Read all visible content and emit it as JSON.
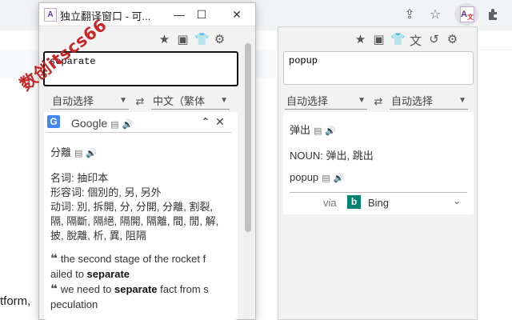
{
  "page_fragment": "tform,",
  "browser": {
    "icons": [
      "share-icon",
      "star-icon",
      "extension-logo",
      "puzzle-icon"
    ]
  },
  "window": {
    "title": "独立翻译窗口 - 可...",
    "controls": {
      "minimize": "—",
      "maximize": "☐",
      "close": "✕"
    },
    "input_text": "separate",
    "source_lang": "自动选择",
    "target_lang": "中文（繁体",
    "engine": "Google",
    "main_translation": "分離",
    "dict": [
      "名词: 抽印本",
      "形容词: 個別的, 另, 另外",
      "动词: 別, 拆開, 分, 分開, 分離, 割裂,",
      "隔, 隔斷, 隔絕, 隔開, 隔離, 間, 閒, 解,",
      "披, 脫離, 析, 異, 阻隔"
    ],
    "examples": [
      {
        "pre": "the second stage of the rocket f",
        "line2_pre": "ailed to ",
        "bold": "separate",
        "post": ""
      },
      {
        "pre": "we need to ",
        "bold": "separate",
        "post": " fact from s",
        "line2": "peculation"
      }
    ]
  },
  "popup": {
    "input_text": "popup",
    "source_lang": "自动选择",
    "target_lang": "自动选择",
    "result_word": "弹出",
    "noun_line": "NOUN: 弹出, 跳出",
    "original_word": "popup",
    "via_label": "via",
    "engine": "Bing"
  },
  "watermark": "数创itscs66",
  "colors": {
    "accent_watermark": "#c62828",
    "bing": "#008373",
    "google_blue": "#4285f4"
  }
}
